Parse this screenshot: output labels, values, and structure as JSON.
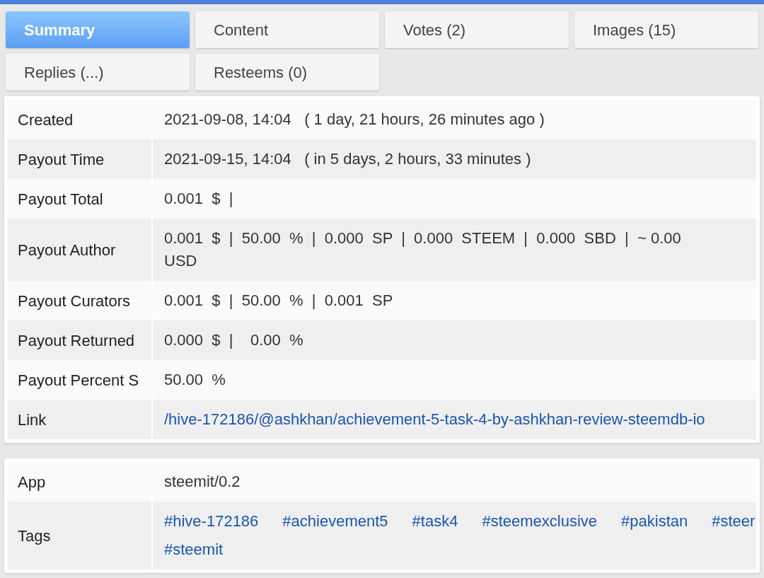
{
  "tabs": [
    {
      "label": "Summary",
      "selected": true
    },
    {
      "label": "Content",
      "selected": false
    },
    {
      "label": "Votes (2)",
      "selected": false
    },
    {
      "label": "Images (15)",
      "selected": false
    },
    {
      "label": "Replies (...)",
      "selected": false
    },
    {
      "label": "Resteems (0)",
      "selected": false
    }
  ],
  "sections": [
    {
      "rows": [
        {
          "label": "Created",
          "kind": "text",
          "value": "2021-09-08, 14:04   ( 1 day, 21 hours, 26 minutes ago )"
        },
        {
          "label": "Payout Time",
          "kind": "text",
          "value": "2021-09-15, 14:04   ( in 5 days, 2 hours, 33 minutes )"
        },
        {
          "label": "Payout Total",
          "kind": "text",
          "value": "0.001  $  |"
        },
        {
          "label": "Payout Author",
          "kind": "text",
          "value": "0.001  $  |  50.00  %  |  0.000  SP  |  0.000  STEEM  |  0.000  SBD  |  ~ 0.00  USD"
        },
        {
          "label": "Payout Curators",
          "kind": "text",
          "value": "0.001  $  |  50.00  %  |  0.001  SP"
        },
        {
          "label": "Payout Returned",
          "kind": "text",
          "value": "0.000  $  |    0.00  %"
        },
        {
          "label": "Payout Percent S",
          "kind": "text",
          "value": "50.00  %"
        },
        {
          "label": "Link",
          "kind": "link",
          "value": "/hive-172186/@ashkhan/achievement-5-task-4-by-ashkhan-review-steemdb-io"
        }
      ]
    },
    {
      "rows": [
        {
          "label": "App",
          "kind": "text",
          "value": "steemit/0.2"
        },
        {
          "label": "Tags",
          "kind": "tags",
          "tag_lines": [
            [
              "#hive-172186",
              "#achievement5",
              "#task4",
              "#steemexclusive",
              "#pakistan",
              "#steer"
            ],
            [
              "#steemit"
            ]
          ]
        }
      ]
    }
  ]
}
